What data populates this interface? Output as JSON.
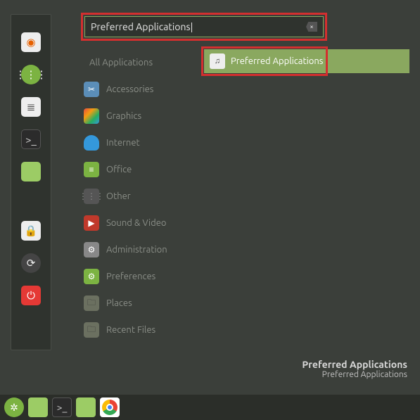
{
  "search": {
    "value": "Preferred Applications",
    "clear_icon": "×"
  },
  "categories": {
    "all": "All Applications",
    "items": [
      {
        "icon": "✂",
        "cls": "ic-acc",
        "label": "Accessories"
      },
      {
        "icon": "",
        "cls": "ic-gfx",
        "label": "Graphics"
      },
      {
        "icon": "",
        "cls": "ic-net",
        "label": "Internet"
      },
      {
        "icon": "≡",
        "cls": "ic-off",
        "label": "Office"
      },
      {
        "icon": "⋮⋮⋮",
        "cls": "ic-oth",
        "label": "Other"
      },
      {
        "icon": "▶",
        "cls": "ic-snd",
        "label": "Sound & Video"
      },
      {
        "icon": "⚙",
        "cls": "ic-adm",
        "label": "Administration"
      },
      {
        "icon": "⚙",
        "cls": "ic-pref",
        "label": "Preferences"
      },
      {
        "icon": "🗀",
        "cls": "ic-plc",
        "label": "Places"
      },
      {
        "icon": "🗀",
        "cls": "ic-rec",
        "label": "Recent Files"
      }
    ]
  },
  "results": [
    {
      "icon": "♫",
      "label": "Preferred Applications"
    }
  ],
  "hint": {
    "title": "Preferred Applications",
    "sub": "Preferred Applications"
  },
  "favorites": [
    {
      "cls": "firefox",
      "glyph": "◉",
      "name": "firefox"
    },
    {
      "cls": "hexchat",
      "glyph": "⋮⋮⋮",
      "name": "app-grid"
    },
    {
      "cls": "sysmon",
      "glyph": "≣",
      "name": "system-monitor"
    },
    {
      "cls": "terminal",
      "glyph": ">_",
      "name": "terminal"
    },
    {
      "cls": "files",
      "glyph": "",
      "name": "files"
    },
    {
      "cls": "gap"
    },
    {
      "cls": "lock",
      "glyph": "🔒",
      "name": "lock"
    },
    {
      "cls": "logout",
      "glyph": "⟳",
      "name": "logout"
    },
    {
      "cls": "power",
      "glyph": "⏻",
      "name": "power"
    }
  ],
  "taskbar": [
    {
      "cls": "tb-mint",
      "glyph": "✲",
      "name": "menu"
    },
    {
      "cls": "tb-files",
      "glyph": "",
      "name": "show-desktop"
    },
    {
      "cls": "tb-term",
      "glyph": ">_",
      "name": "terminal"
    },
    {
      "cls": "tb-files2",
      "glyph": "",
      "name": "files"
    },
    {
      "cls": "tb-chrome",
      "glyph": "",
      "name": "chrome"
    }
  ]
}
